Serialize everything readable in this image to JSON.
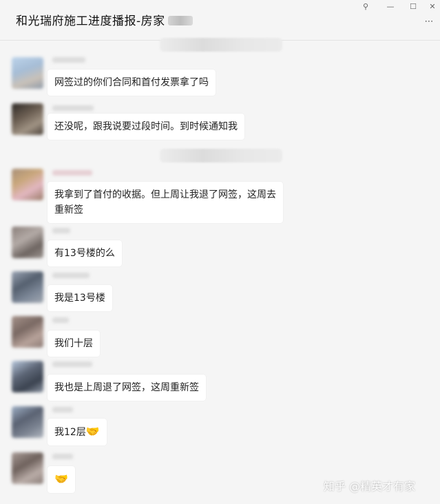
{
  "header": {
    "title": "和光瑞府施工进度播报-房家",
    "controls": {
      "pin": "⚲",
      "minimize": "—",
      "maximize": "☐",
      "close": "✕"
    },
    "more": "⋯"
  },
  "messages": [
    {
      "text": "网签过的你们合同和首付发票拿了吗"
    },
    {
      "text": "还没呢，跟我说要过段时间。到时候通知我"
    },
    {
      "text": "我拿到了首付的收据。但上周让我退了网签，这周去重新签"
    },
    {
      "text": "有13号楼的么"
    },
    {
      "text": "我是13号楼"
    },
    {
      "text": "我们十层"
    },
    {
      "text": "我也是上周退了网签，这周重新签"
    },
    {
      "text": "我12层",
      "emoji": "🤝"
    },
    {
      "text": "",
      "emoji": "🤝"
    }
  ],
  "watermark": "知乎 @精英才有家"
}
